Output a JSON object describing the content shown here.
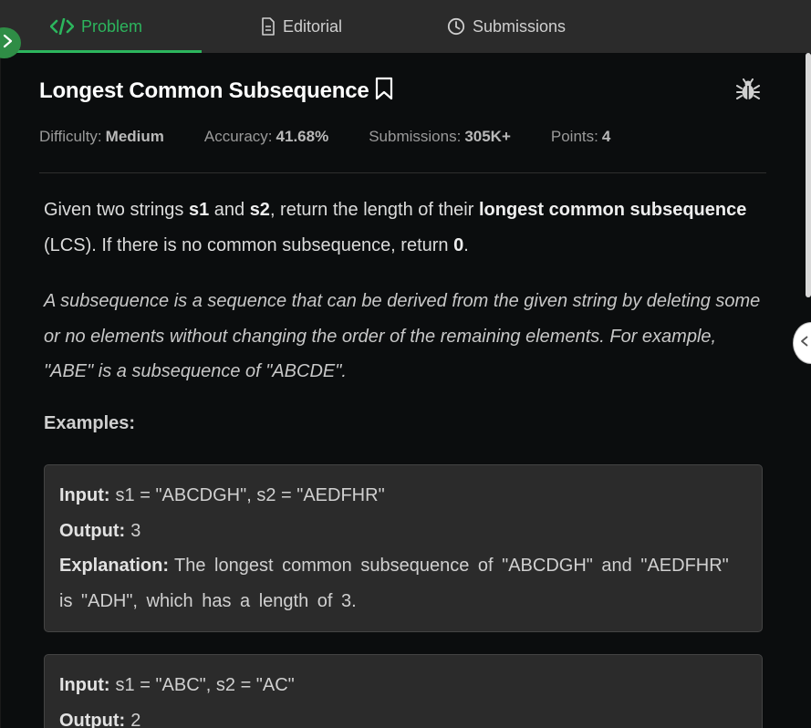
{
  "tabs": {
    "problem": "Problem",
    "editorial": "Editorial",
    "submissions": "Submissions"
  },
  "problem": {
    "title": "Longest Common Subsequence",
    "meta": {
      "difficulty_label": "Difficulty:",
      "difficulty": "Medium",
      "accuracy_label": "Accuracy:",
      "accuracy": "41.68%",
      "submissions_label": "Submissions:",
      "submissions": "305K+",
      "points_label": "Points:",
      "points": "4"
    },
    "description": {
      "p1": "Given two strings ",
      "s1": "s1",
      "p2": " and ",
      "s2": "s2",
      "p3": ", return the length of their ",
      "bold1": "longest common subsequence",
      "p4": " (LCS). If there is no common subsequence, return ",
      "zero": "0",
      "p5": "."
    },
    "note": "A subsequence is a sequence that can be derived from the given string by deleting some or no elements without changing the order of the remaining elements. For example, \"ABE\" is a subsequence of \"ABCDE\".",
    "examples_label": "Examples:",
    "examples": [
      {
        "input_label": "Input:",
        "input": "s1 = \"ABCDGH\", s2 = \"AEDFHR\"",
        "output_label": "Output:",
        "output": "3",
        "explanation_label": "Explanation:",
        "explanation": "The longest common subsequence of \"ABCDGH\" and \"AEDFHR\" is \"ADH\", which has a length of 3."
      },
      {
        "input_label": "Input:",
        "input": "s1 = \"ABC\", s2 = \"AC\"",
        "output_label": "Output:",
        "output": "2"
      }
    ]
  },
  "colors": {
    "accent": "#2cb55d",
    "background": "#0b0d0e",
    "tabbar": "#2b2b2b",
    "example_box": "#2b2b2b"
  },
  "icons": {
    "problem_tab": "code-icon",
    "editorial_tab": "document-icon",
    "submissions_tab": "clock-icon",
    "bookmark": "bookmark-icon",
    "report": "bug-icon",
    "expand": "chevron-right-icon",
    "collapse": "chevron-left-icon"
  }
}
